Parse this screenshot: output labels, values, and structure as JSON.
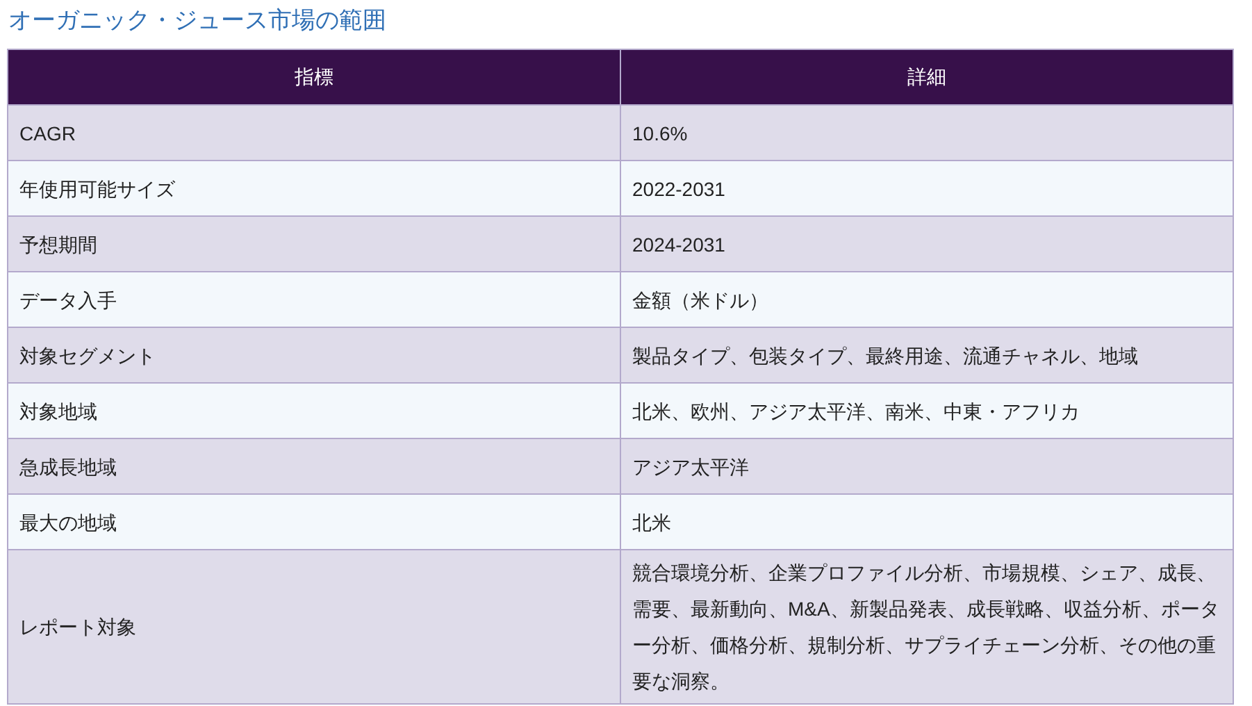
{
  "title": "オーガニック・ジュース市場の範囲",
  "table": {
    "columns": [
      "指標",
      "詳細"
    ],
    "rows": [
      {
        "cells": [
          "CAGR",
          "10.6%"
        ]
      },
      {
        "cells": [
          "年使用可能サイズ",
          "2022-2031"
        ]
      },
      {
        "cells": [
          "予想期間",
          "2024-2031"
        ]
      },
      {
        "cells": [
          "データ入手",
          "金額（米ドル）"
        ]
      },
      {
        "cells": [
          "対象セグメント",
          "製品タイプ、包装タイプ、最終用途、流通チャネル、地域"
        ]
      },
      {
        "cells": [
          "対象地域",
          "北米、欧州、アジア太平洋、南米、中東・アフリカ"
        ]
      },
      {
        "cells": [
          "急成長地域",
          "アジア太平洋"
        ]
      },
      {
        "cells": [
          "最大の地域",
          "北米"
        ]
      },
      {
        "cells": [
          "レポート対象",
          "競合環境分析、企業プロファイル分析、市場規模、シェア、成長、需要、最新動向、M&A、新製品発表、成長戦略、収益分析、ポーター分析、価格分析、規制分析、サプライチェーン分析、その他の重要な洞察。"
        ]
      }
    ]
  }
}
